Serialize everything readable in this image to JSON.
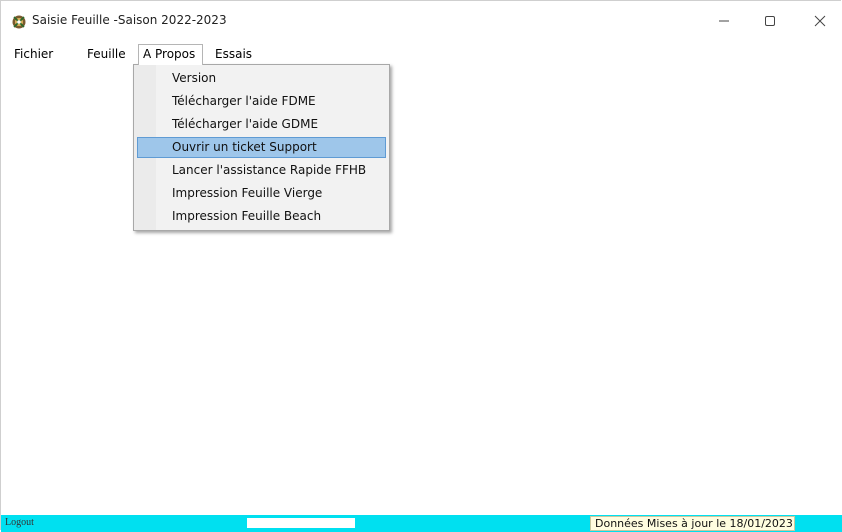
{
  "window": {
    "title": "Saisie Feuille -Saison 2022-2023",
    "minimize_glyph": "—",
    "maximize_glyph": "☐",
    "close_glyph": "✕"
  },
  "menubar": {
    "items": [
      {
        "label": "Fichier"
      },
      {
        "label": "Feuille"
      },
      {
        "label": "A Propos"
      },
      {
        "label": "Essais"
      }
    ]
  },
  "dropdown": {
    "items": [
      {
        "label": "Version"
      },
      {
        "label": "Télécharger l'aide FDME"
      },
      {
        "label": "Télécharger l'aide GDME"
      },
      {
        "label": "Ouvrir un ticket Support"
      },
      {
        "label": "Lancer l'assistance Rapide FFHB"
      },
      {
        "label": "Impression Feuille Vierge"
      },
      {
        "label": "Impression Feuille Beach"
      }
    ],
    "highlighted_index": 3
  },
  "statusbar": {
    "left_text": "Logout",
    "right_text": "Données Mises à jour le 18/01/2023",
    "background_color": "#00e0f0"
  }
}
